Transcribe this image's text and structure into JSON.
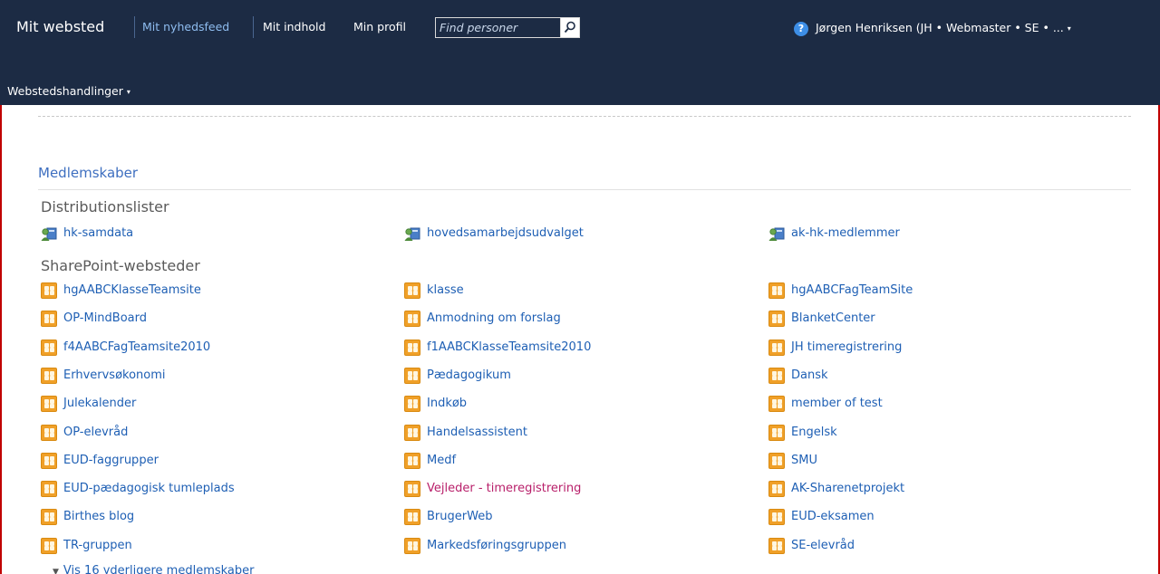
{
  "header": {
    "site_title": "Mit websted",
    "nav": [
      "Mit nyhedsfeed",
      "Mit indhold",
      "Min profil"
    ],
    "search_placeholder": "Find personer",
    "help_glyph": "?",
    "user_name": "Jørgen Henriksen (JH • Webmaster • SE • ...",
    "caret": "▾",
    "site_actions_label": "Webstedshandlinger"
  },
  "content": {
    "section_title": "Medlemskaber",
    "distribution_heading": "Distributionslister",
    "distribution_items": [
      "hk-samdata",
      "hovedsamarbejdsudvalget",
      "ak-hk-medlemmer"
    ],
    "sharepoint_heading": "SharePoint-websteder",
    "sharepoint_items": [
      [
        "hgAABCKlasseTeamsite",
        "klasse",
        "hgAABCFagTeamSite"
      ],
      [
        "OP-MindBoard",
        "Anmodning om forslag",
        "BlanketCenter"
      ],
      [
        "f4AABCFagTeamsite2010",
        "f1AABCKlasseTeamsite2010",
        "JH timeregistrering"
      ],
      [
        "Erhvervsøkonomi",
        "Pædagogikum",
        "Dansk"
      ],
      [
        "Julekalender",
        "Indkøb",
        "member of test"
      ],
      [
        "OP-elevråd",
        "Handelsassistent",
        "Engelsk"
      ],
      [
        "EUD-faggrupper",
        "Medf",
        "SMU"
      ],
      [
        "EUD-pædagogisk tumleplads",
        "Vejleder - timeregistrering",
        "AK-Sharenetprojekt"
      ],
      [
        "Birthes blog",
        "BrugerWeb",
        "EUD-eksamen"
      ],
      [
        "TR-gruppen",
        "Markedsføringsgruppen",
        "SE-elevråd"
      ]
    ],
    "visited_item": "Vejleder - timeregistrering",
    "more_label": "Vis 16 yderligere medlemskaber",
    "more_chevron": "▼"
  },
  "icons": {
    "distribution_list": "distribution-list-icon",
    "sharepoint_site": "sharepoint-site-icon",
    "search": "search-icon",
    "help": "help-icon"
  },
  "colors": {
    "ribbon": "#1c2b44",
    "link": "#1e5fb4",
    "visited_link": "#b81f6a",
    "section_title": "#3e6fc0"
  }
}
